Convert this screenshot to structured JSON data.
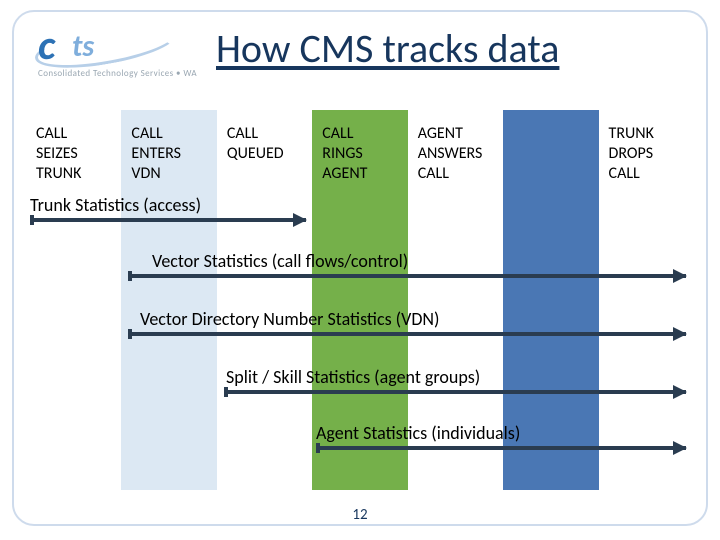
{
  "logo": {
    "mark_c": "c",
    "mark_ts": "ts",
    "subtitle": "Consolidated Technology Services • WA"
  },
  "title": "How CMS tracks data",
  "columns": [
    {
      "label": "CALL\nSEIZES\nTRUNK"
    },
    {
      "label": "CALL\nENTERS\nVDN"
    },
    {
      "label": "CALL\nQUEUED"
    },
    {
      "label": "CALL\nRINGS\nAGENT"
    },
    {
      "label": "AGENT\nANSWERS\nCALL"
    },
    {
      "label": ""
    },
    {
      "label": "TRUNK\nDROPS\nCALL"
    }
  ],
  "arrows": [
    {
      "caption": "Trunk Statistics  (access)"
    },
    {
      "caption": "Vector Statistics  (call flows/control)"
    },
    {
      "caption": "Vector Directory Number Statistics  (VDN)"
    },
    {
      "caption": "Split / Skill Statistics  (agent groups)"
    },
    {
      "caption": "Agent Statistics  (individuals)"
    }
  ],
  "page_number": "12"
}
